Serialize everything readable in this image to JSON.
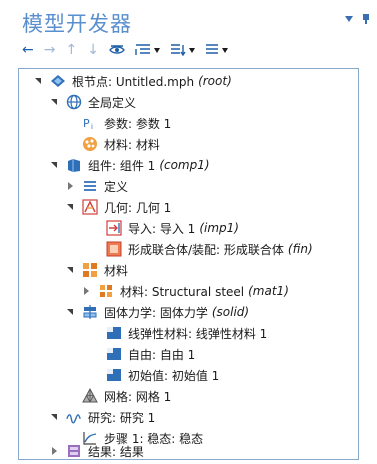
{
  "panel": {
    "title": "模型开发器"
  },
  "tree": [
    {
      "label": "根节点: Untitled.mph",
      "tag": "(root)",
      "icon": "root-model-icon",
      "state": "expanded"
    },
    {
      "label": "全局定义",
      "tag": "",
      "icon": "globe-icon",
      "state": "expanded"
    },
    {
      "label": "参数: 参数 1",
      "tag": "",
      "icon": "parameters-icon",
      "state": "none"
    },
    {
      "label": "材料: 材料",
      "tag": "",
      "icon": "global-material-icon",
      "state": "none"
    },
    {
      "label": "组件: 组件 1",
      "tag": "(comp1)",
      "icon": "component-icon",
      "state": "expanded"
    },
    {
      "label": "定义",
      "tag": "",
      "icon": "definitions-icon",
      "state": "collapsed"
    },
    {
      "label": "几何: 几何 1",
      "tag": "",
      "icon": "geometry-icon",
      "state": "expanded"
    },
    {
      "label": "导入: 导入 1",
      "tag": "(imp1)",
      "icon": "import-icon",
      "state": "none"
    },
    {
      "label": "形成联合体/装配: 形成联合体",
      "tag": "(fin)",
      "icon": "form-union-icon",
      "state": "none"
    },
    {
      "label": "材料",
      "tag": "",
      "icon": "materials-icon",
      "state": "expanded"
    },
    {
      "label": "材料: Structural steel",
      "tag": "(mat1)",
      "icon": "material-icon",
      "state": "collapsed"
    },
    {
      "label": "固体力学: 固体力学",
      "tag": "(solid)",
      "icon": "solid-mechanics-icon",
      "state": "expanded"
    },
    {
      "label": "线弹性材料: 线弹性材料 1",
      "tag": "",
      "icon": "linear-elastic-icon",
      "state": "none"
    },
    {
      "label": "自由: 自由 1",
      "tag": "",
      "icon": "free-icon",
      "state": "none"
    },
    {
      "label": "初始值: 初始值 1",
      "tag": "",
      "icon": "initial-values-icon",
      "state": "none"
    },
    {
      "label": "网格: 网格 1",
      "tag": "",
      "icon": "mesh-icon",
      "state": "none"
    },
    {
      "label": "研究: 研究 1",
      "tag": "",
      "icon": "study-icon",
      "state": "expanded"
    },
    {
      "label": "步骤 1: 稳态: 稳态",
      "tag": "",
      "icon": "stationary-step-icon",
      "state": "none"
    },
    {
      "label": "结果: 结果",
      "tag": "",
      "icon": "results-icon",
      "state": "collapsed"
    }
  ]
}
